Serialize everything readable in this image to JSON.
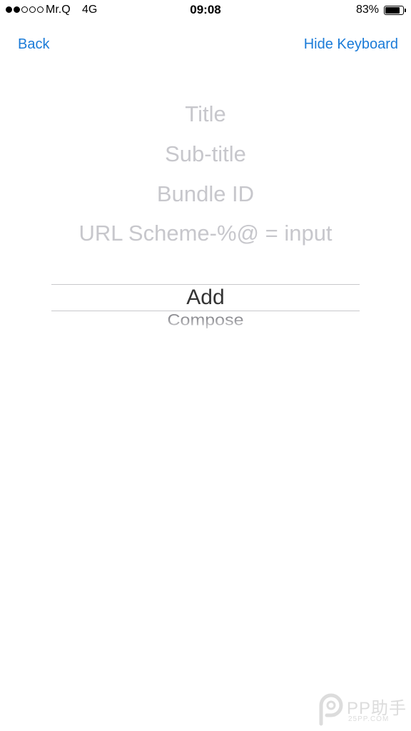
{
  "status_bar": {
    "carrier": "Mr.Q",
    "network": "4G",
    "time": "09:08",
    "battery_percent": "83%",
    "battery_level": 0.83,
    "signal_strength": 2,
    "signal_max": 5
  },
  "nav": {
    "back_label": "Back",
    "hide_keyboard_label": "Hide Keyboard",
    "accent_color": "#1a7bd8"
  },
  "form": {
    "title": {
      "value": "",
      "placeholder": "Title"
    },
    "subtitle": {
      "value": "",
      "placeholder": "Sub-title"
    },
    "bundle_id": {
      "value": "",
      "placeholder": "Bundle ID"
    },
    "url_scheme": {
      "value": "",
      "placeholder": "URL Scheme-%@ = input"
    }
  },
  "picker": {
    "selected": "Add",
    "next": "Compose"
  },
  "watermark": {
    "text": "PP助手",
    "sub": "25PP.COM"
  }
}
